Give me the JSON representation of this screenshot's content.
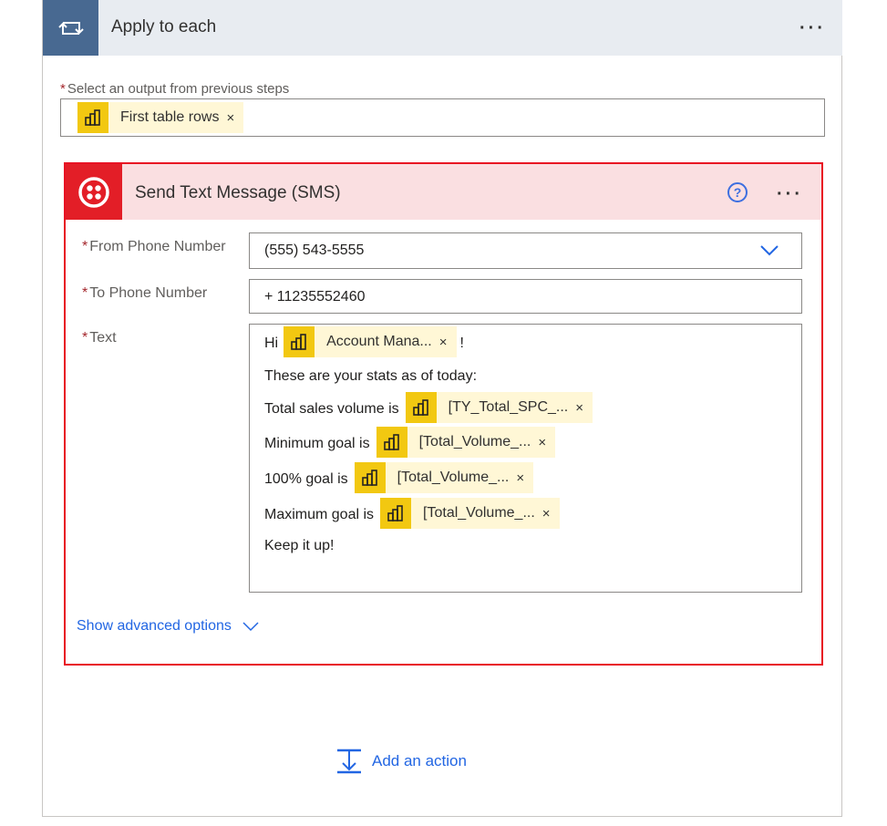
{
  "apply_to_each": {
    "title": "Apply to each",
    "icon": "loop-icon",
    "more": "···"
  },
  "select_output": {
    "label": "Select an output from previous steps",
    "required_mark": "*",
    "token": {
      "label": "First table rows",
      "close": "×",
      "icon": "powerbi-icon"
    }
  },
  "sms": {
    "title": "Send Text Message (SMS)",
    "icon": "twilio-icon",
    "help": "?",
    "more": "···",
    "fields": {
      "from": {
        "label": "From Phone Number",
        "value": "(555) 543-5555"
      },
      "to": {
        "label": "To Phone Number",
        "value": "+ 11235552460"
      },
      "text": {
        "label": "Text",
        "lines": [
          {
            "before": "Hi",
            "token": "Account Mana...",
            "after": "!"
          },
          {
            "before": "These are your stats as of today:"
          },
          {
            "before": "Total sales volume is",
            "token": "[TY_Total_SPC_..."
          },
          {
            "before": "Minimum goal is",
            "token": "[Total_Volume_..."
          },
          {
            "before": "100% goal is",
            "token": "[Total_Volume_..."
          },
          {
            "before": "Maximum goal is",
            "token": "[Total_Volume_..."
          },
          {
            "before": "Keep it up!"
          }
        ]
      }
    },
    "advanced": "Show advanced options"
  },
  "add_action": {
    "label": "Add an action",
    "icon": "add-action-icon"
  },
  "colors": {
    "apply_header_bg": "#e8ecf1",
    "apply_icon_bg": "#486991",
    "sms_border": "#e81123",
    "sms_header_bg": "#fadfe1",
    "twilio_red": "#e31e27",
    "token_bg": "#fff7d6",
    "token_icon_bg": "#f2c811",
    "link_blue": "#2266e3"
  }
}
